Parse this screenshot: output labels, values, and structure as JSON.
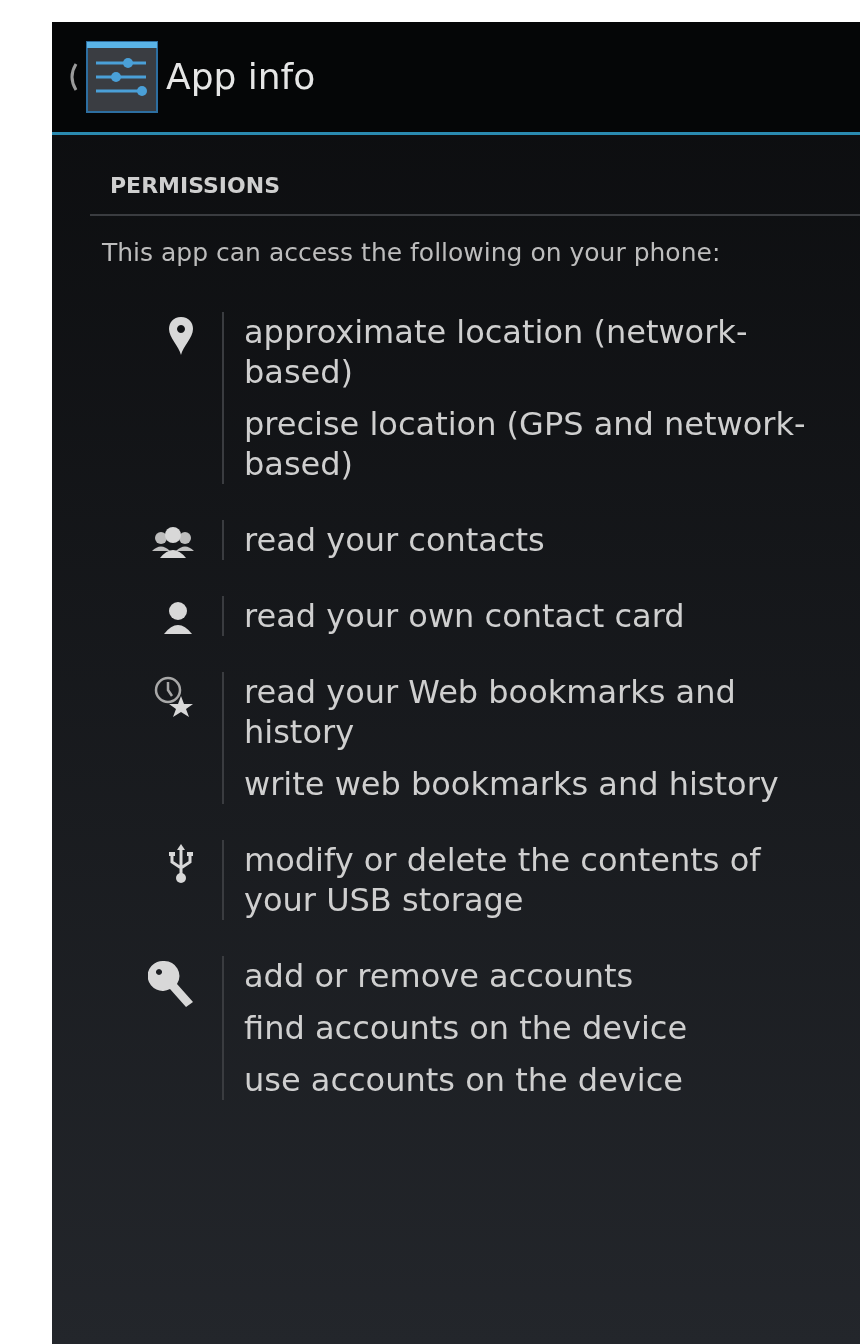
{
  "action_bar": {
    "title": "App info"
  },
  "section": {
    "header": "PERMISSIONS",
    "intro": "This app can access the following on your phone:"
  },
  "groups": [
    {
      "kind": "location",
      "permissions": [
        "approximate location (network-based)",
        "precise location (GPS and network-based)"
      ]
    },
    {
      "kind": "contacts",
      "permissions": [
        "read your contacts"
      ]
    },
    {
      "kind": "profile",
      "permissions": [
        "read your own contact card"
      ]
    },
    {
      "kind": "bookmarks",
      "permissions": [
        "read your Web bookmarks and history",
        "write web bookmarks and history"
      ]
    },
    {
      "kind": "usb",
      "permissions": [
        "modify or delete the contents of your USB storage"
      ]
    },
    {
      "kind": "accounts",
      "permissions": [
        "add or remove accounts",
        "find accounts on the device",
        "use accounts on the device"
      ]
    }
  ]
}
